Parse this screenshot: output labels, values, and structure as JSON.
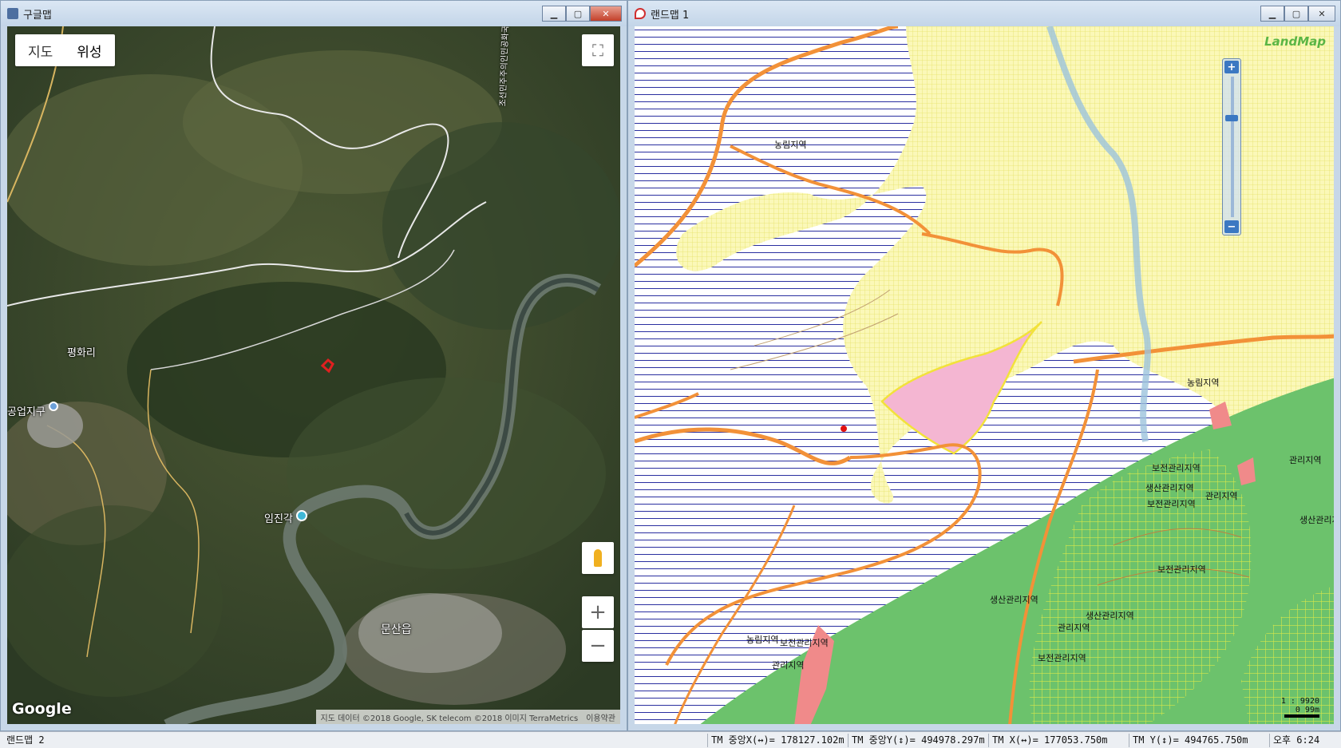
{
  "left_window": {
    "title": "구글맵",
    "map_type": {
      "map_label": "지도",
      "satellite_label": "위성"
    },
    "places": [
      "평화리",
      "공업지구",
      "임진각",
      "문산읍"
    ],
    "river_label": "조선민주주의인민공화국 대한민국",
    "google_logo": "Google",
    "attribution": "지도 데이터 ©2018 Google, SK telecom ©2018 이미지 TerraMetrics",
    "terms": "이용약관",
    "zoom_in": "+",
    "zoom_out": "−"
  },
  "right_window": {
    "title": "랜드맵 1",
    "logo": "LandMap",
    "zone_labels": [
      "농림지역",
      "보전관리지역",
      "관리지역",
      "보전관리지역",
      "생산관리지역",
      "생산관리지역",
      "관리지역",
      "보전관리지역",
      "농림지역",
      "보전관리지역",
      "관리지역",
      "생산관리지역",
      "보전관리지역",
      "생산관리지역",
      "농림지역",
      "관리지역"
    ],
    "scale_label": "1 : 9920",
    "scale_dist": "0  99m"
  },
  "status_bar": {
    "app": "랜드맵 2",
    "tm_center_x": "TM 중앙X(↔)= 178127.102m",
    "tm_center_y": "TM 중앙Y(↕)= 494978.297m",
    "tm_x": "TM X(↔)= 177053.750m",
    "tm_y": "TM Y(↕)= 494765.750m",
    "clock": "오후 6:24"
  },
  "colors": {
    "agri_green": "#6cc26c",
    "yellow_zone": "#fbf8b8",
    "pink_zone": "#f4b6d2",
    "road_orange": "#f29138"
  }
}
